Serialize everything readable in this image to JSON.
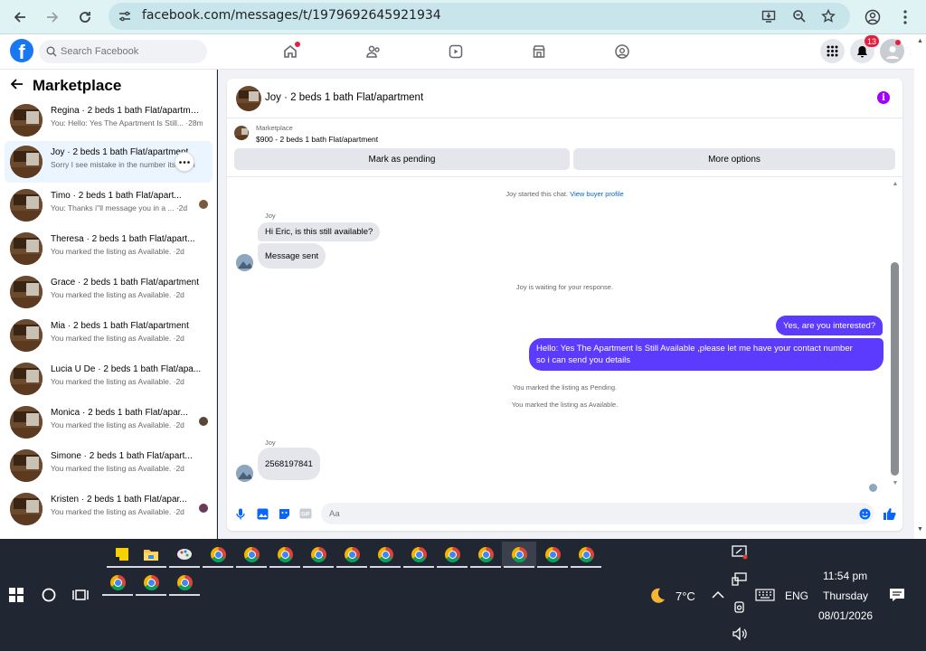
{
  "browser": {
    "url": "facebook.com/messages/t/1979692645921934",
    "icons": [
      "back-arrow-icon",
      "forward-arrow-icon",
      "reload-icon",
      "site-info-icon",
      "install-app-icon",
      "zoom-icon",
      "bookmark-star-icon",
      "profile-icon",
      "menu-dots-icon"
    ]
  },
  "fb_header": {
    "logo": "f",
    "search_placeholder": "Search Facebook",
    "notification_count": "13"
  },
  "left_panel": {
    "title": "Marketplace",
    "conversations": [
      {
        "name": "Regina · 2 beds 1 bath Flat/apartment",
        "snippet": "You: Hello: Yes The Apartment Is Still... ·28m"
      },
      {
        "name": "Joy · 2 beds 1 bath Flat/apartment",
        "snippet": "Sorry I see mistake in the number its... ·4h"
      },
      {
        "name": "Timo · 2 beds 1 bath Flat/apart...",
        "snippet": "You: Thanks i''ll message you in a ... ·2d"
      },
      {
        "name": "Theresa · 2 beds 1 bath Flat/apart...",
        "snippet": "You marked the listing as Available. ·2d"
      },
      {
        "name": "Grace · 2 beds 1 bath Flat/apartment",
        "snippet": "You marked the listing as Available. ·2d"
      },
      {
        "name": "Mia · 2 beds 1 bath Flat/apartment",
        "snippet": "You marked the listing as Available. ·2d"
      },
      {
        "name": "Lucia U De · 2 beds 1 bath Flat/apa...",
        "snippet": "You marked the listing as Available. ·2d"
      },
      {
        "name": "Monica · 2 beds 1 bath Flat/apar...",
        "snippet": "You marked the listing as Available. ·2d"
      },
      {
        "name": "Simone · 2 beds 1 bath Flat/apart...",
        "snippet": "You marked the listing as Available. ·2d"
      },
      {
        "name": "Kristen · 2 beds 1 bath Flat/apar...",
        "snippet": "You marked the listing as Available. ·2d"
      }
    ]
  },
  "chat": {
    "title": "Joy · 2 beds 1 bath Flat/apartment",
    "listing_label": "Marketplace",
    "listing_price": "$900 - 2 beds 1 bath Flat/apartment",
    "btn_pending": "Mark as pending",
    "btn_more": "More options",
    "started_text": "Joy started this chat.",
    "view_profile": "View buyer profile",
    "sender_1": "Joy",
    "msg_in_1": "Hi Eric, is this still available?",
    "msg_in_2": "Message sent",
    "waiting_text": "Joy is waiting for your response.",
    "msg_out_1": "Yes, are you interested?",
    "msg_out_2_line1": "Hello: Yes The Apartment Is Still Available ,please let me have your contact number",
    "msg_out_2_line2": "so i can send you details",
    "sys_pending": "You marked the listing as Pending.",
    "sys_available": "You marked the listing as Available.",
    "sender_2": "Joy",
    "msg_in_3": "2568197841",
    "input_placeholder": "Aa"
  },
  "taskbar": {
    "weather_temp": "7°C",
    "language": "ENG",
    "time": "11:54 pm",
    "day": "Thursday",
    "date": "08/01/2026"
  },
  "colors": {
    "fb_blue": "#1877f2",
    "outgoing_bubble": "#5c3bfe",
    "incoming_bubble": "#e4e6eb",
    "taskbar": "#202733",
    "chrome_bar": "#dff2f4"
  }
}
